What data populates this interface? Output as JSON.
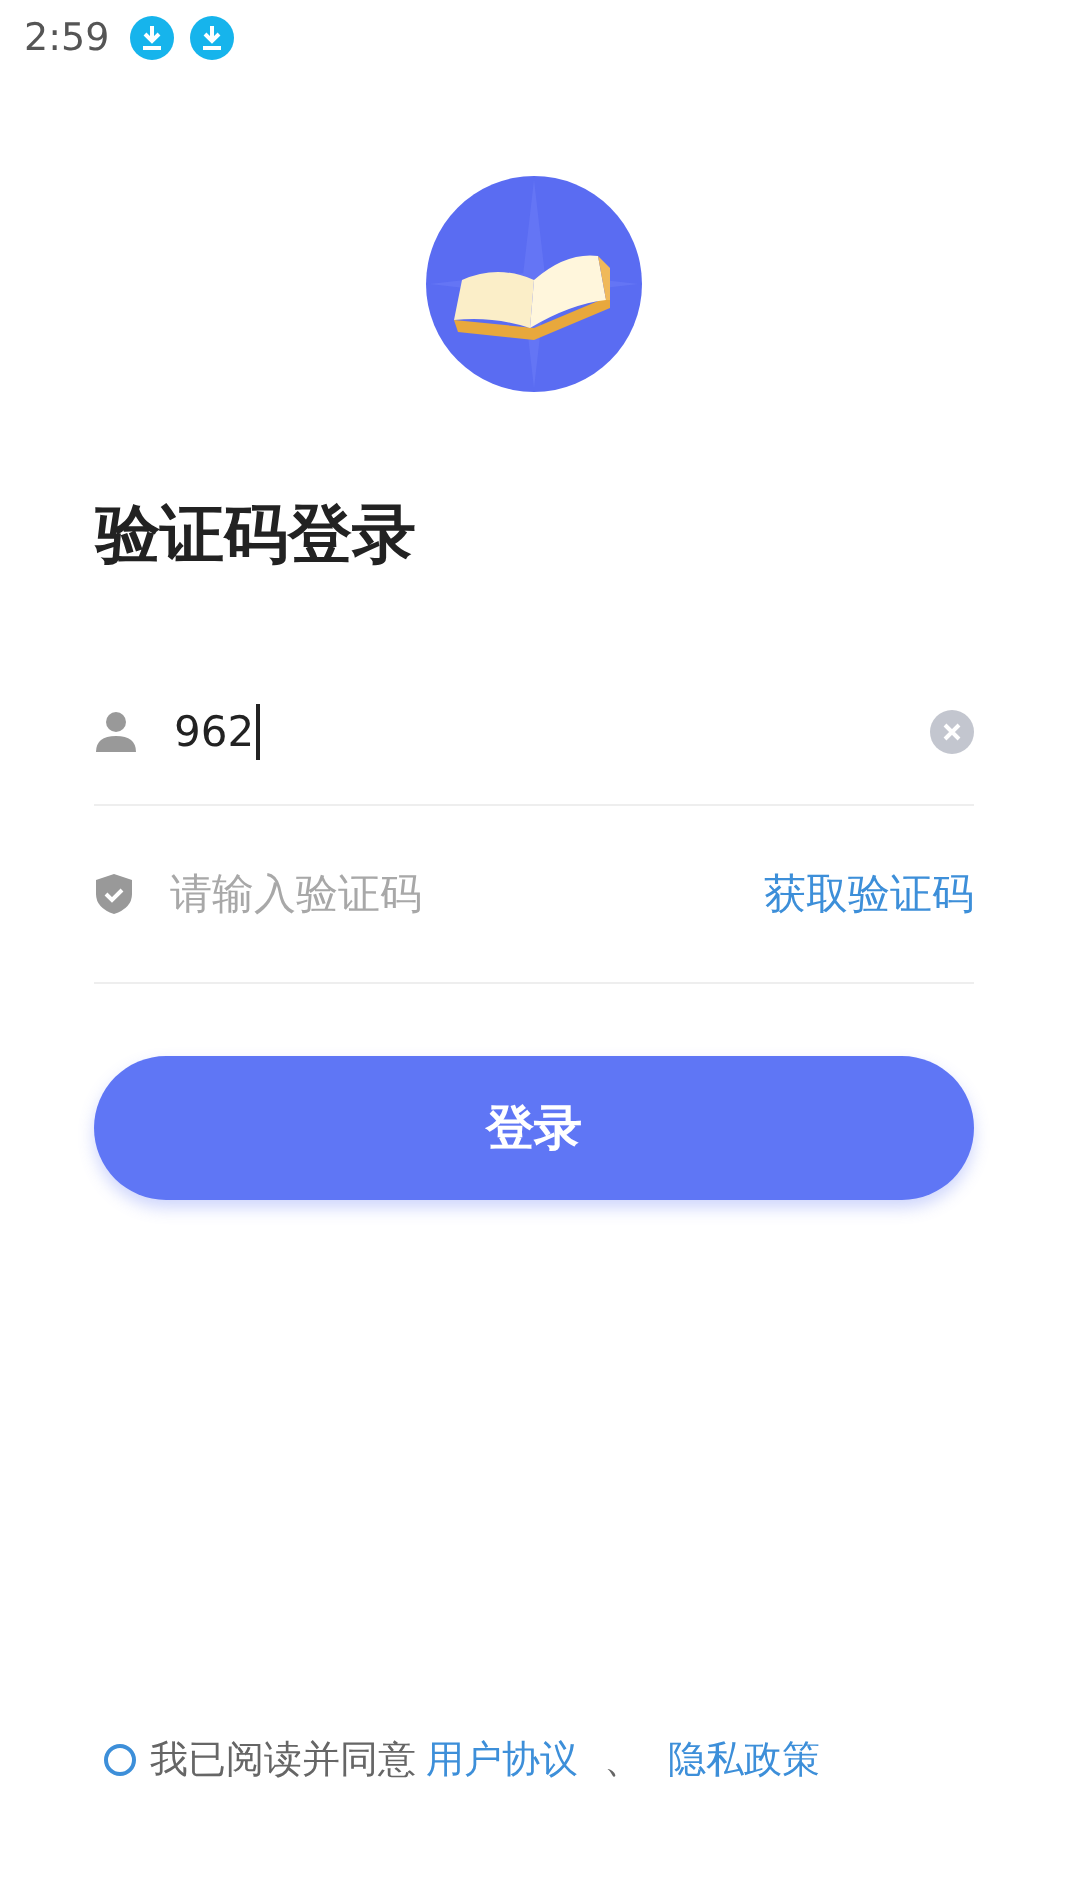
{
  "status_bar": {
    "time": "2:59",
    "notifications": [
      {
        "kind": "download"
      },
      {
        "kind": "download"
      }
    ]
  },
  "title": "验证码登录",
  "phone_field": {
    "value": "962",
    "focused": true
  },
  "code_field": {
    "placeholder": "请输入验证码",
    "action": "获取验证码"
  },
  "login_button": "登录",
  "agreement": {
    "checked": false,
    "text": "我已阅读并同意",
    "links": [
      "用户协议",
      "隐私政策"
    ],
    "separator": "、"
  }
}
